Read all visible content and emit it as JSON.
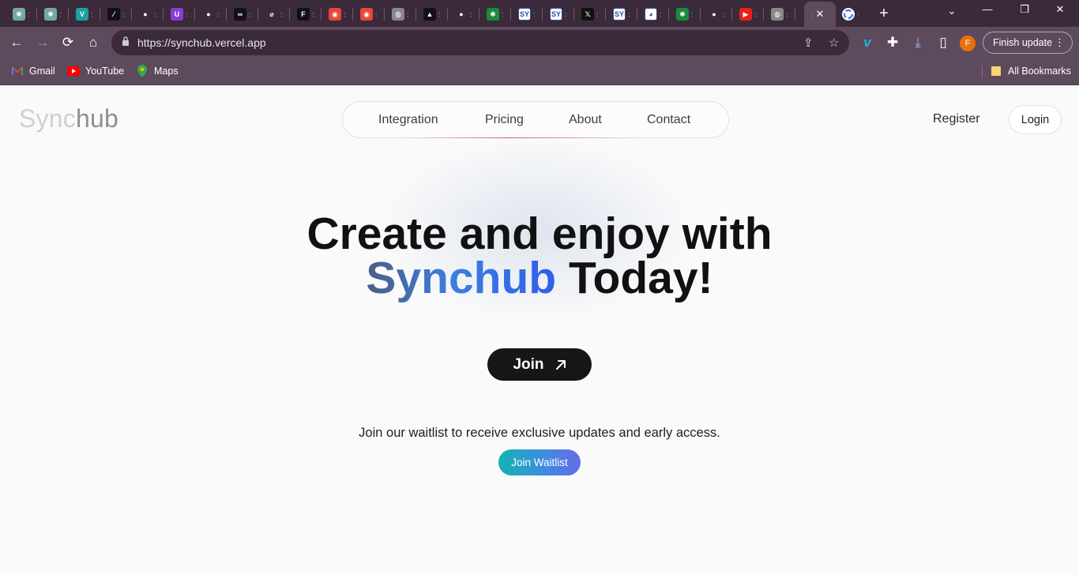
{
  "browser": {
    "tabs": [
      {
        "icon": "chatgpt-icon",
        "color": "#74aa9c",
        "glyph": "✺"
      },
      {
        "icon": "chatgpt-icon",
        "color": "#74aa9c",
        "glyph": "✺"
      },
      {
        "icon": "vuetify-icon",
        "color": "#1ba1a1",
        "glyph": "V"
      },
      {
        "icon": "slash-app-icon",
        "color": "#111111",
        "glyph": "⁄"
      },
      {
        "icon": "github-icon",
        "color": "#3b2b3a",
        "glyph": "●"
      },
      {
        "icon": "upwork-u-icon",
        "color": "#8a3bd6",
        "glyph": "U"
      },
      {
        "icon": "github-icon",
        "color": "#3b2b3a",
        "glyph": "●"
      },
      {
        "icon": "link-icon",
        "color": "#111111",
        "glyph": "∞"
      },
      {
        "icon": "paperclip-icon",
        "color": "#3b2b3a",
        "glyph": "⌀"
      },
      {
        "icon": "framer-icon",
        "color": "#111111",
        "glyph": "F"
      },
      {
        "icon": "ring-icon",
        "color": "#e8453c",
        "glyph": "◉"
      },
      {
        "icon": "ring-icon",
        "color": "#e8453c",
        "glyph": "◉"
      },
      {
        "icon": "globe-icon",
        "color": "#888888",
        "glyph": "◍"
      },
      {
        "icon": "triangle-app-icon",
        "color": "#111111",
        "glyph": "▲"
      },
      {
        "icon": "github-icon",
        "color": "#3b2b3a",
        "glyph": "●"
      },
      {
        "icon": "asterisk-icon",
        "color": "#1b8a3a",
        "glyph": "✱"
      },
      {
        "icon": "synchub-sy-icon",
        "color": "#ffffff",
        "glyph": "SY"
      },
      {
        "icon": "synchub-sy-icon",
        "color": "#ffffff",
        "glyph": "SY"
      },
      {
        "icon": "x-twitter-icon",
        "color": "#111111",
        "glyph": "𝕏"
      },
      {
        "icon": "synchub-sy-icon",
        "color": "#ffffff",
        "glyph": "SY"
      },
      {
        "icon": "panda-icon",
        "color": "#ffffff",
        "glyph": "◕"
      },
      {
        "icon": "asterisk-icon",
        "color": "#1b8a3a",
        "glyph": "✱"
      },
      {
        "icon": "github-icon",
        "color": "#3b2b3a",
        "glyph": "●"
      },
      {
        "icon": "youtube-icon",
        "color": "#e62117",
        "glyph": "▶"
      },
      {
        "icon": "globe-icon",
        "color": "#888888",
        "glyph": "◍"
      }
    ],
    "url": "https://synchub.vercel.app",
    "finish_update_label": "Finish update",
    "profile_initial": "F",
    "bookmarks": [
      {
        "label": "Gmail",
        "icon": "gmail-icon"
      },
      {
        "label": "YouTube",
        "icon": "youtube-icon"
      },
      {
        "label": "Maps",
        "icon": "maps-icon"
      }
    ],
    "all_bookmarks_label": "All Bookmarks"
  },
  "site": {
    "logo_part1": "Sync",
    "logo_part2": "hub",
    "nav": [
      "Integration",
      "Pricing",
      "About",
      "Contact"
    ],
    "register_label": "Register",
    "login_label": "Login",
    "hero_line1": "Create and enjoy with",
    "hero_brand": "Synchub",
    "hero_line2_rest": " Today!",
    "join_label": "Join",
    "waitlist_text": "Join our waitlist to receive exclusive updates and early access.",
    "waitlist_button": "Join Waitlist"
  }
}
